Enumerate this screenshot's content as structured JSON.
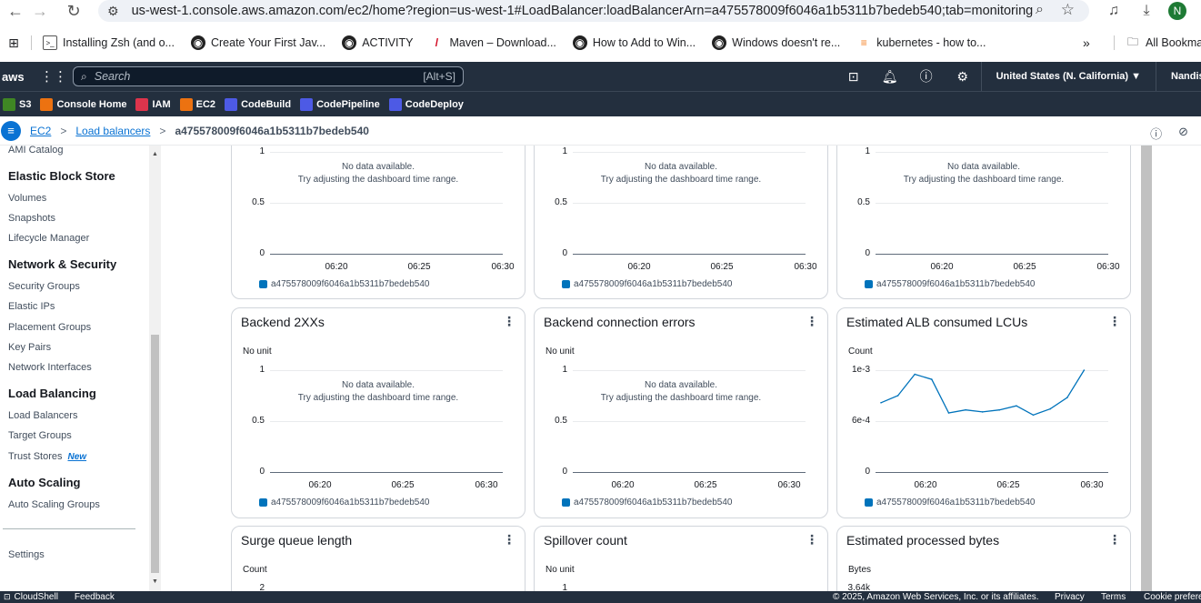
{
  "browser": {
    "url": "us-west-1.console.aws.amazon.com/ec2/home?region=us-west-1#LoadBalancer:loadBalancerArn=a475578009f6046a1b5311b7bedeb540;tab=monitoring",
    "profile_initial": "N",
    "bookmarks": [
      {
        "label": "Installing Zsh (and o...",
        "icon": "terminal-icon"
      },
      {
        "label": "Create Your First Jav...",
        "icon": "globe-icon"
      },
      {
        "label": "ACTIVITY",
        "icon": "globe-icon"
      },
      {
        "label": "Maven – Download...",
        "icon": "feather-icon"
      },
      {
        "label": "How to Add to Win...",
        "icon": "globe-icon"
      },
      {
        "label": "Windows doesn't re...",
        "icon": "globe-icon"
      },
      {
        "label": "kubernetes - how to...",
        "icon": "stackoverflow-icon"
      }
    ],
    "all_bookmarks": "All Bookmarks"
  },
  "aws": {
    "logo": "aws",
    "search_placeholder": "Search",
    "search_shortcut": "[Alt+S]",
    "region": "United States (N. California) ▼",
    "user": "Nandish",
    "favorites": [
      {
        "label": "S3",
        "color": "#3f8624"
      },
      {
        "label": "Console Home",
        "color": "#ec7211"
      },
      {
        "label": "IAM",
        "color": "#dd344c"
      },
      {
        "label": "EC2",
        "color": "#ec7211"
      },
      {
        "label": "CodeBuild",
        "color": "#4d5ae5"
      },
      {
        "label": "CodePipeline",
        "color": "#4d5ae5"
      },
      {
        "label": "CodeDeploy",
        "color": "#4d5ae5"
      }
    ]
  },
  "breadcrumb": {
    "root": "EC2",
    "section": "Load balancers",
    "current": "a475578009f6046a1b5311b7bedeb540"
  },
  "sidebar": {
    "top_item": "AMI Catalog",
    "sections": [
      {
        "title": "Elastic Block Store",
        "items": [
          "Volumes",
          "Snapshots",
          "Lifecycle Manager"
        ]
      },
      {
        "title": "Network & Security",
        "items": [
          "Security Groups",
          "Elastic IPs",
          "Placement Groups",
          "Key Pairs",
          "Network Interfaces"
        ]
      },
      {
        "title": "Load Balancing",
        "items": [
          "Load Balancers",
          "Target Groups",
          "Trust Stores"
        ]
      },
      {
        "title": "Auto Scaling",
        "items": [
          "Auto Scaling Groups"
        ]
      }
    ],
    "new_badge": "New",
    "settings": "Settings"
  },
  "common": {
    "no_data": "No data available.",
    "no_data_hint": "Try adjusting the dashboard time range.",
    "legend": "a475578009f6046a1b5311b7bedeb540",
    "series_color": "#0073bb"
  },
  "cards_row0": [
    {
      "yticks": [
        "1",
        "0.5",
        "0"
      ],
      "xticks": [
        "06:20",
        "06:25",
        "06:30"
      ]
    },
    {
      "yticks": [
        "1",
        "0.5",
        "0"
      ],
      "xticks": [
        "06:20",
        "06:25",
        "06:30"
      ]
    },
    {
      "yticks": [
        "1",
        "0.5",
        "0"
      ],
      "xticks": [
        "06:20",
        "06:25",
        "06:30"
      ]
    }
  ],
  "cards_row1": [
    {
      "title": "Backend 2XXs",
      "unit": "No unit",
      "yticks": [
        "1",
        "0.5",
        "0"
      ],
      "xticks": [
        "06:20",
        "06:25",
        "06:30"
      ]
    },
    {
      "title": "Backend connection errors",
      "unit": "No unit",
      "yticks": [
        "1",
        "0.5",
        "0"
      ],
      "xticks": [
        "06:20",
        "06:25",
        "06:30"
      ]
    },
    {
      "title": "Estimated ALB consumed LCUs",
      "unit": "Count",
      "yticks": [
        "1e-3",
        "6e-4",
        "0"
      ],
      "xticks": [
        "06:20",
        "06:25",
        "06:30"
      ]
    }
  ],
  "cards_row2": [
    {
      "title": "Surge queue length",
      "unit": "Count",
      "ytick": "2"
    },
    {
      "title": "Spillover count",
      "unit": "No unit",
      "ytick": "1"
    },
    {
      "title": "Estimated processed bytes",
      "unit": "Bytes",
      "ytick": "3.64k"
    }
  ],
  "chart_data": {
    "type": "line",
    "title": "Estimated ALB consumed LCUs",
    "ylabel": "Count",
    "x": [
      "06:17",
      "06:18",
      "06:19",
      "06:20",
      "06:21",
      "06:22",
      "06:23",
      "06:24",
      "06:25",
      "06:26",
      "06:27",
      "06:28",
      "06:29"
    ],
    "series": [
      {
        "name": "a475578009f6046a1b5311b7bedeb540",
        "values": [
          0.00068,
          0.00075,
          0.00096,
          0.00091,
          0.00058,
          0.00061,
          0.00059,
          0.00061,
          0.00065,
          0.00056,
          0.00062,
          0.00073,
          0.001
        ]
      }
    ],
    "xticks": [
      "06:20",
      "06:25",
      "06:30"
    ],
    "yticks": [
      "0",
      "6e-4",
      "1e-3"
    ],
    "xlim": [
      "06:17",
      "06:30"
    ],
    "ylim": [
      0,
      0.001
    ],
    "grid": true,
    "legend": "bottom"
  },
  "footer": {
    "cloudshell": "CloudShell",
    "feedback": "Feedback",
    "copyright": "© 2025, Amazon Web Services, Inc. or its affiliates.",
    "privacy": "Privacy",
    "terms": "Terms",
    "cookie": "Cookie preferences"
  }
}
